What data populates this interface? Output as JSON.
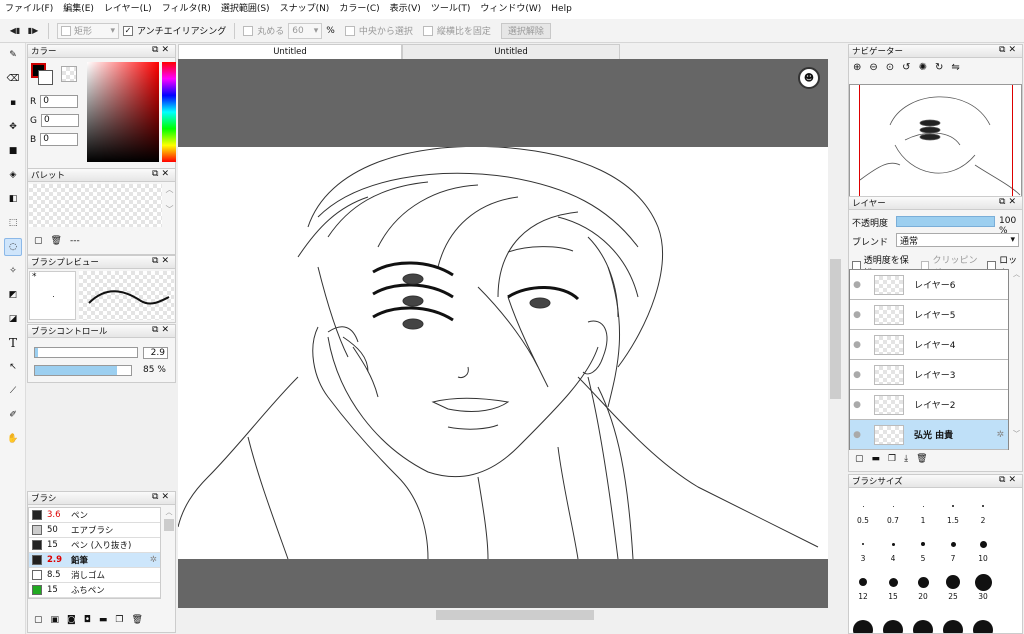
{
  "menu": [
    "ファイル(F)",
    "編集(E)",
    "レイヤー(L)",
    "フィルタ(R)",
    "選択範囲(S)",
    "スナップ(N)",
    "カラー(C)",
    "表示(V)",
    "ツール(T)",
    "ウィンドウ(W)",
    "Help"
  ],
  "toolbar": {
    "shape_label": "矩形",
    "antialias_label": "アンチエイリアシング",
    "round_label": "丸める",
    "round_value": "60",
    "round_unit": "%",
    "center_label": "中央から選択",
    "aspect_label": "縦横比を固定",
    "deselect_label": "選択解除"
  },
  "color_panel": {
    "title": "カラー",
    "r_label": "R",
    "r_value": "0",
    "g_label": "G",
    "g_value": "0",
    "b_label": "B",
    "b_value": "0",
    "foreground": "#000000",
    "accent": "#cc0000"
  },
  "palette_panel": {
    "title": "パレット",
    "dash": "---"
  },
  "brush_preview_panel": {
    "title": "ブラシプレビュー",
    "star": "*"
  },
  "brush_control_panel": {
    "title": "ブラシコントロール",
    "size": "2.9",
    "opacity": "85 %",
    "size_fraction": 0.03,
    "opacity_fraction": 0.85
  },
  "brush_panel": {
    "title": "ブラシ",
    "items": [
      {
        "size": "3.6",
        "name": "ペン",
        "color": "#222222"
      },
      {
        "size": "50",
        "name": "エアブラシ",
        "color": "#cccccc"
      },
      {
        "size": "15",
        "name": "ペン (入り抜き)",
        "color": "#222222"
      },
      {
        "size": "2.9",
        "name": "鉛筆",
        "color": "#222222"
      },
      {
        "size": "8.5",
        "name": "消しゴム",
        "color": "#ffffff"
      },
      {
        "size": "15",
        "name": "ふちペン",
        "color": "#22aa22"
      }
    ]
  },
  "tabs": [
    "Untitled",
    "Untitled"
  ],
  "navigator": {
    "title": "ナビゲーター"
  },
  "layer_panel": {
    "title": "レイヤー",
    "opacity_label": "不透明度",
    "opacity_value": "100 %",
    "blend_label": "ブレンド",
    "blend_value": "通常",
    "protect_label": "透明度を保護",
    "clipping_label": "クリッピング",
    "lock_label": "ロック",
    "layers": [
      "レイヤー6",
      "レイヤー5",
      "レイヤー4",
      "レイヤー3",
      "レイヤー2",
      "弘光 由貴"
    ]
  },
  "brush_size_panel": {
    "title": "ブラシサイズ",
    "rows": [
      [
        "0.5",
        "0.7",
        "1",
        "1.5",
        "2"
      ],
      [
        "3",
        "4",
        "5",
        "7",
        "10"
      ],
      [
        "12",
        "15",
        "20",
        "25",
        "30"
      ]
    ]
  }
}
